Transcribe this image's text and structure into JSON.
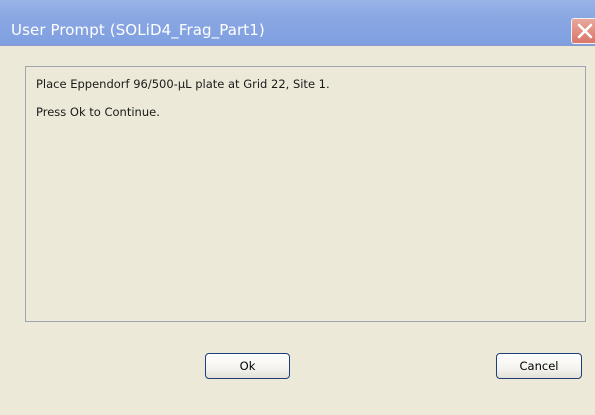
{
  "window": {
    "title": "User Prompt (SOLiD4_Frag_Part1)",
    "close_icon": "close-icon"
  },
  "message": {
    "line1": "Place Eppendorf 96/500-µL plate at Grid 22, Site 1.",
    "line2": "Press Ok to Continue."
  },
  "buttons": {
    "ok_label": "Ok",
    "cancel_label": "Cancel"
  },
  "colors": {
    "titlebar": "#8aa7e2",
    "close_button": "#d9776a",
    "dialog_background": "#ece9d8",
    "button_border": "#1f3f7a"
  }
}
